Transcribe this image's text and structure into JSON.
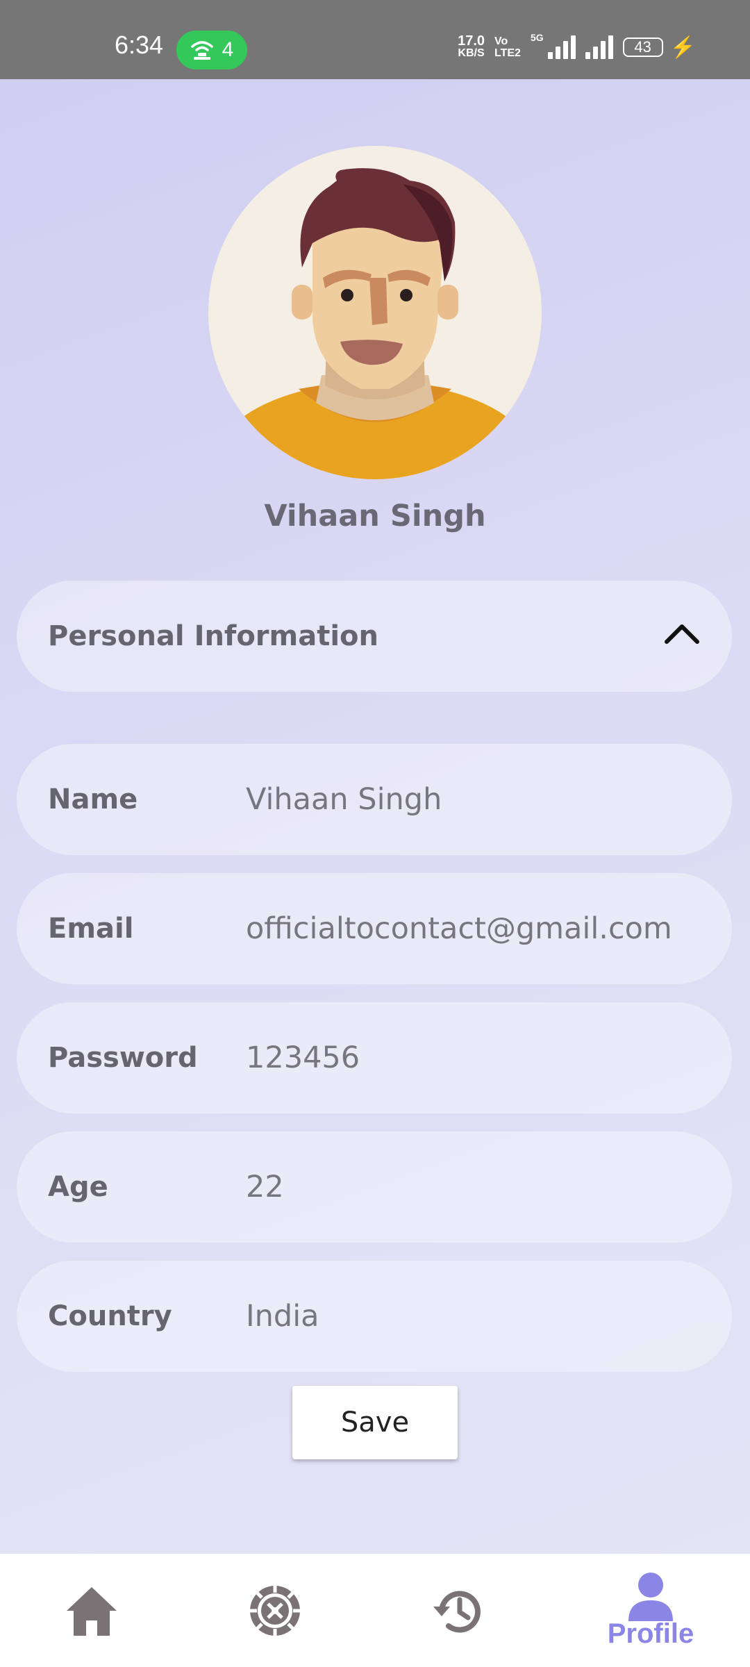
{
  "status_bar": {
    "time": "6:34",
    "hotspot_count": "4",
    "speed_value": "17.0",
    "speed_unit": "KB/S",
    "volte_top": "Vo",
    "volte_bottom": "LTE2",
    "network": "5G",
    "battery": "43"
  },
  "profile": {
    "name": "Vihaan Singh"
  },
  "section": {
    "title": "Personal Information",
    "expanded": true
  },
  "fields": [
    {
      "label": "Name",
      "value": "Vihaan Singh"
    },
    {
      "label": "Email",
      "value": "officialtocontact@gmail.com"
    },
    {
      "label": "Password",
      "value": "123456"
    },
    {
      "label": "Age",
      "value": "22"
    },
    {
      "label": "Country",
      "value": "India"
    }
  ],
  "save_label": "Save",
  "nav": {
    "items": [
      {
        "icon": "home-icon"
      },
      {
        "icon": "roulette-icon"
      },
      {
        "icon": "history-icon"
      },
      {
        "icon": "profile-icon",
        "label": "Profile",
        "active": true
      }
    ],
    "active_color": "#8b86e6",
    "inactive_color": "#7a7274"
  }
}
